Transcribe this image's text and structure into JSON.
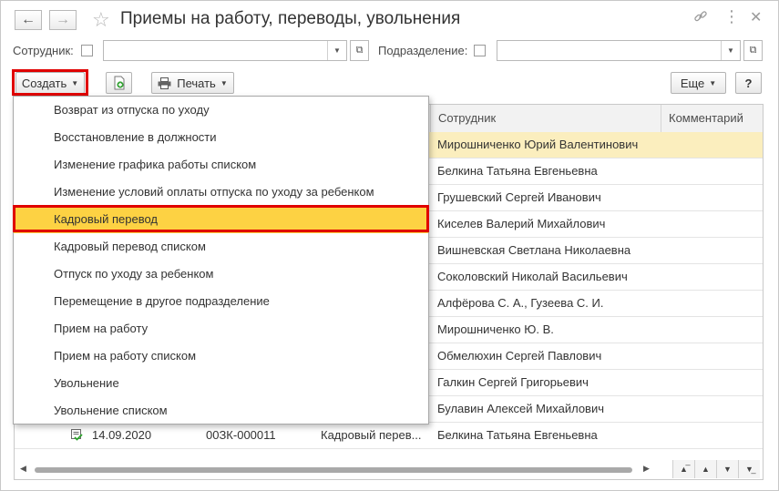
{
  "window": {
    "title": "Приемы на работу, переводы, увольнения",
    "back_icon": "arrow-left-icon",
    "forward_icon": "arrow-right-icon",
    "favorite_icon": "star-icon",
    "link_icon": "link-icon",
    "more_icon": "kebab-icon",
    "close_icon": "close-icon"
  },
  "filters": {
    "employee_label": "Сотрудник:",
    "employee_value": "",
    "department_label": "Подразделение:",
    "department_value": ""
  },
  "toolbar": {
    "create_label": "Создать",
    "print_label": "Печать",
    "more_label": "Еще",
    "help_label": "?"
  },
  "table": {
    "columns": [
      "Сотрудник",
      "Комментарий"
    ],
    "rows": [
      {
        "employee": "Мирошниченко Юрий Валентинович",
        "comment": ""
      },
      {
        "employee": "Белкина Татьяна Евгеньевна",
        "comment": ""
      },
      {
        "employee": "Грушевский Сергей Иванович",
        "comment": ""
      },
      {
        "employee": "Киселев Валерий Михайлович",
        "comment": ""
      },
      {
        "employee": "Вишневская Светлана Николаевна",
        "comment": ""
      },
      {
        "employee": "Соколовский Николай Васильевич",
        "comment": ""
      },
      {
        "employee": "Алфёрова С. А., Гузеева С. И.",
        "comment": ""
      },
      {
        "employee": "Мирошниченко Ю. В.",
        "comment": ""
      },
      {
        "employee": "Обмелюхин Сергей Павлович",
        "comment": ""
      },
      {
        "employee": "Галкин Сергей Григорьевич",
        "comment": ""
      },
      {
        "employee": "Булавин Алексей Михайлович",
        "comment": ""
      }
    ],
    "last_row": {
      "date": "14.09.2020",
      "number": "00ЗК-000011",
      "type": "Кадровый перев...",
      "employee": "Белкина Татьяна Евгеньевна"
    }
  },
  "menu": {
    "items": [
      "Возврат из отпуска по уходу",
      "Восстановление в должности",
      "Изменение графика работы списком",
      "Изменение условий оплаты отпуска по уходу за ребенком",
      "Кадровый перевод",
      "Кадровый перевод списком",
      "Отпуск по уходу за ребенком",
      "Перемещение в другое подразделение",
      "Прием на работу",
      "Прием на работу списком",
      "Увольнение",
      "Увольнение списком"
    ],
    "highlighted_index": 4
  },
  "colors": {
    "highlight": "#fdd243",
    "selected_row": "#fbeebe",
    "annotation_red": "#e00000"
  }
}
